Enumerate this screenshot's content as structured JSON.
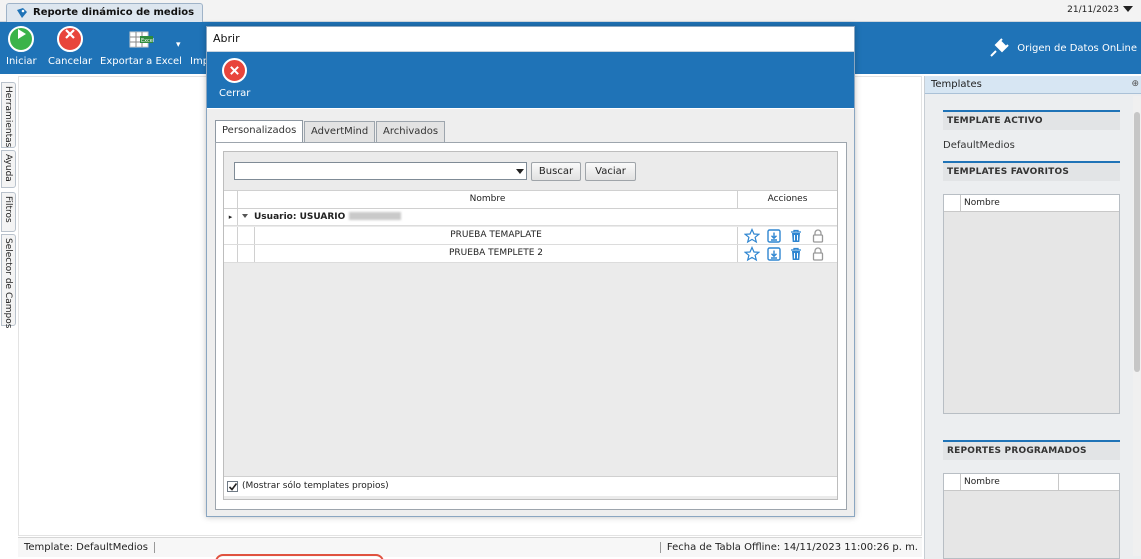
{
  "window": {
    "doc_tab": "Reporte dinámico de medios",
    "date": "21/11/2023"
  },
  "ribbon": {
    "iniciar": "Iniciar",
    "cancelar": "Cancelar",
    "exportar_excel": "Exportar a Excel",
    "imp": "Imp",
    "origen": "Origen de Datos OnLine"
  },
  "vtabs": [
    "Herramientas",
    "Ayuda",
    "Filtros",
    "Selector de Campos"
  ],
  "modal": {
    "title": "Abrir",
    "close_label": "Cerrar",
    "tabs": [
      "Personalizados",
      "AdvertMind",
      "Archivados"
    ],
    "active_tab": "Personalizados",
    "search_value": "",
    "buscar": "Buscar",
    "vaciar": "Vaciar",
    "columns": {
      "nombre": "Nombre",
      "acciones": "Acciones"
    },
    "group_label": "Usuario: USUARIO",
    "rows": [
      "PRUEBA TEMAPLATE",
      "PRUEBA TEMPLETE 2"
    ],
    "checkbox_label": "(Mostrar sólo templates propios)",
    "checkbox_checked": true
  },
  "templates_panel": {
    "header": "Templates",
    "activo_title": "TEMPLATE ACTIVO",
    "activo_value": "DefaultMedios",
    "favoritos_title": "TEMPLATES FAVORITOS",
    "favoritos_col": "Nombre",
    "programados_title": "REPORTES PROGRAMADOS",
    "programados_col": "Nombre"
  },
  "status": {
    "template": "Template: DefaultMedios",
    "fecha": "Fecha de Tabla Offline: 14/11/2023 11:00:26 p. m."
  },
  "colors": {
    "accent": "#1f73b7",
    "green": "#3bb34a",
    "red": "#e8453c",
    "highlight": "#e0523f"
  }
}
